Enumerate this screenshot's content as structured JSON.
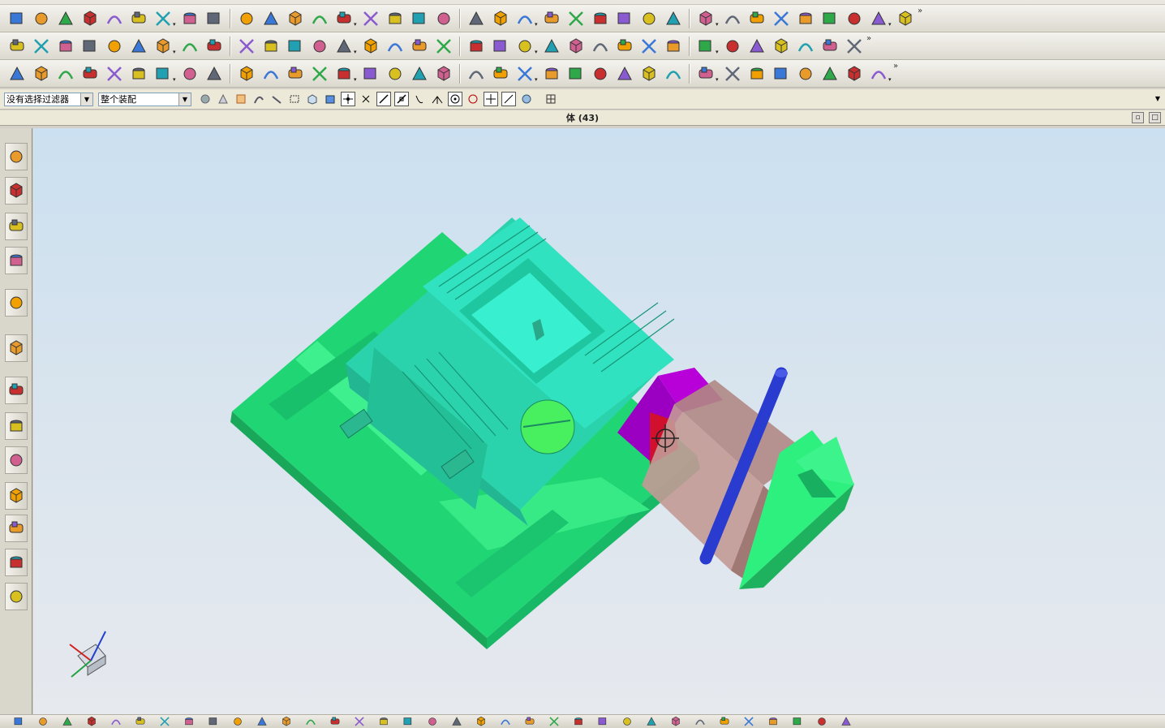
{
  "selection_bar": {
    "filter_value": "没有选择过滤器",
    "scope_value": "整个装配"
  },
  "graphics_window": {
    "title": "体 (43)"
  },
  "toolbar_rows": [
    {
      "name": "standard-toolbar",
      "icons": [
        "new-file-icon",
        "mold-wizard-icon",
        "project-init-icon",
        "csys-icon",
        "shrinkage-icon",
        "workpiece-icon",
        "cavity-layout-icon",
        "cylinder-icon",
        "sphere-icon",
        "extrude-icon",
        "revolve-icon",
        "sketch-icon",
        "feature-op-icon",
        "book-icon",
        "library-icon",
        "box-icon",
        "blend-icon",
        "shell-icon",
        "offset-icon",
        "sweep-icon",
        "trim-icon",
        "split-icon",
        "unite-icon",
        "block-icon",
        "slider-icon",
        "lifter-icon",
        "insert-icon",
        "gate-icon",
        "runner-icon",
        "cooling-icon",
        "electrode-icon",
        "ejector-icon",
        "pocket-icon",
        "bom-icon",
        "drawing-icon",
        "cavity-icon"
      ]
    },
    {
      "name": "curve-toolbar",
      "icons": [
        "line-icon",
        "arc-icon",
        "rectangle-icon",
        "spline-icon",
        "text-icon",
        "polygon-icon",
        "helix-icon",
        "offset-curve-icon",
        "bridge-curve-icon",
        "project-curve-icon",
        "measure-distance-icon",
        "fillet-curve-icon",
        "chamfer-curve-icon",
        "trim-curve-icon",
        "divide-icon",
        "join-icon",
        "extract-icon",
        "section-icon",
        "intersect-icon",
        "wrap-icon",
        "mirror-icon",
        "pattern-icon",
        "surface-icon",
        "through-curves-icon",
        "mesh-icon",
        "n-sided-icon",
        "ruled-icon",
        "swept-surface-icon",
        "studio-icon",
        "law-icon",
        "sew-icon",
        "thicken-icon",
        "patch-icon",
        "parting-icon"
      ]
    },
    {
      "name": "feature-toolbar",
      "icons": [
        "characters-icon",
        "chamfer-icon",
        "box-feature-icon",
        "tube-icon",
        "color-palette-icon",
        "draft-icon",
        "red-box-icon",
        "frame-icon",
        "hole-icon",
        "boss-icon",
        "rib-icon",
        "delete-icon",
        "point-icon",
        "color-wheel-icon",
        "block-orange-icon",
        "block-yellow-icon",
        "cone-icon",
        "spline-feature-icon",
        "cube-outline-icon",
        "annotation-icon",
        "dimension-icon",
        "assembly-icon",
        "measure-icon",
        "move-face-icon",
        "datum-icon",
        "bracket-icon",
        "corner-icon",
        "square-icon",
        "grid-icon",
        "hook-icon",
        "anchor-icon",
        "stripe-icon",
        "hatch-icon",
        "crosshair-icon",
        "list-icon"
      ]
    }
  ],
  "resource_bar": {
    "icons": [
      "assembly-navigator-icon",
      "constraint-navigator-icon",
      "part-navigator-icon",
      "reuse-library-icon",
      "info-icon",
      "web-browser-icon",
      "history-icon",
      "system-materials-icon",
      "process-studio-icon",
      "manufacturing-wizard-icon",
      "roles-icon",
      "system-scene-icon",
      "palette-icon"
    ]
  },
  "colors": {
    "mold_plate": "#22e07a",
    "product_part": "#2dd6b0",
    "slider_block": "#b88a85",
    "wedge": "#b400d6",
    "cylinder": "#2a3bd0",
    "viewport_top": "#cbe0f0",
    "viewport_bottom": "#e6e9ee"
  }
}
